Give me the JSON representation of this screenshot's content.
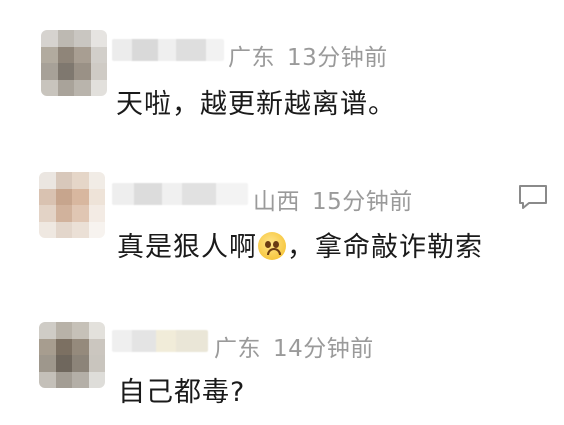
{
  "comments": [
    {
      "location": "广东",
      "time": "13分钟前",
      "text": "天啦，越更新越离谱。"
    },
    {
      "location": "山西",
      "time": "15分钟前",
      "text_before_emoji": "真是狠人啊",
      "emoji": "worried-face-emoji",
      "text_after_emoji": "，拿命敲诈勒索",
      "has_reply_icon": true
    },
    {
      "location": "广东",
      "time": "14分钟前",
      "text": "自己都毒?"
    }
  ],
  "icons": {
    "reply": "comment-bubble-icon"
  }
}
